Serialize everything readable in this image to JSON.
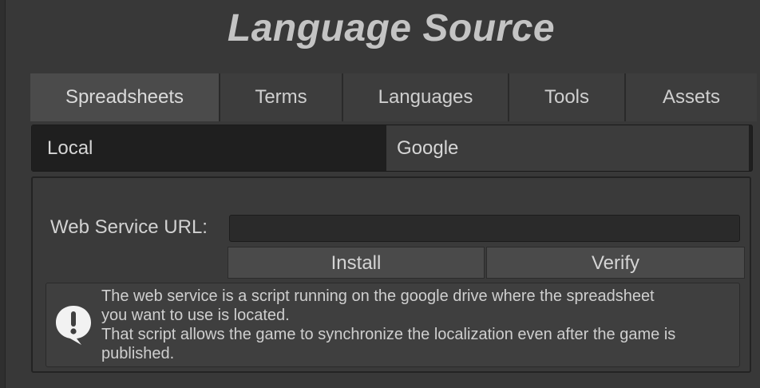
{
  "title": "Language Source",
  "tabs": [
    {
      "label": "Spreadsheets",
      "active": true
    },
    {
      "label": "Terms",
      "active": false
    },
    {
      "label": "Languages",
      "active": false
    },
    {
      "label": "Tools",
      "active": false
    },
    {
      "label": "Assets",
      "active": false
    }
  ],
  "subtabs": {
    "local": "Local",
    "google": "Google",
    "selected": "Local"
  },
  "web_service": {
    "label": "Web Service URL:",
    "value": "",
    "placeholder": ""
  },
  "buttons": {
    "install": "Install",
    "verify": "Verify"
  },
  "help": {
    "icon": "exclamation-speech-icon",
    "lines": [
      "The web service is a script running on the google drive where the spreadsheet",
      "you want to use is located.",
      "That script allows the game to synchronize the localization even after the game is",
      "published."
    ]
  },
  "colors": {
    "background": "#383838",
    "tab_active": "#4b4b4b",
    "tab_inactive": "#3d3d3d",
    "subtab_selected": "#1f1f1f",
    "button": "#4a4a4a"
  }
}
